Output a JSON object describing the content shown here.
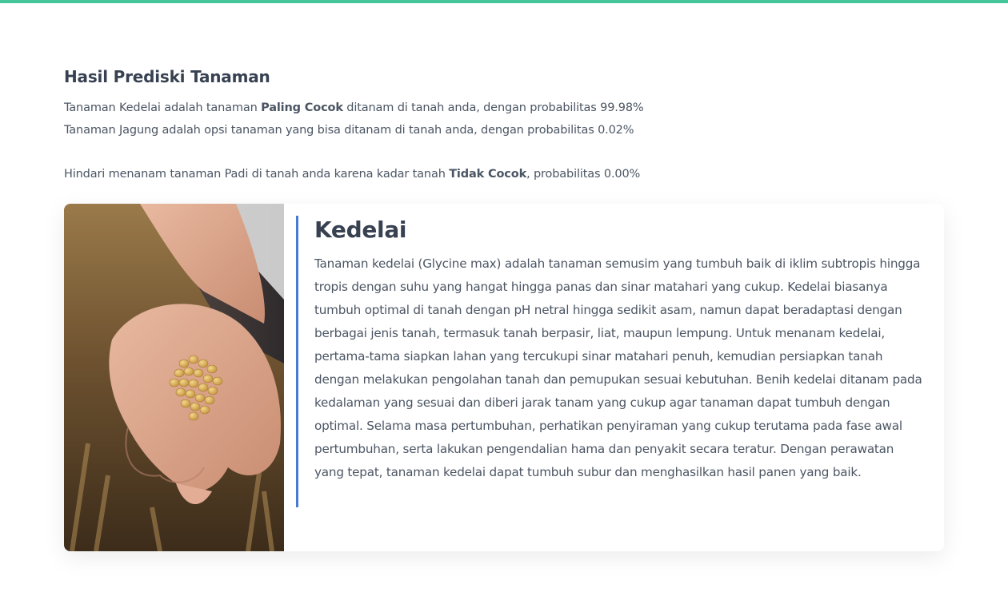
{
  "colors": {
    "accent_bar": "#45c59a",
    "card_bar": "#4a7bd0",
    "text": "#4b5563",
    "heading": "#374151"
  },
  "result": {
    "title": "Hasil Prediski Tanaman",
    "line1_pre": "Tanaman Kedelai adalah tanaman ",
    "line1_bold": "Paling Cocok",
    "line1_post": " ditanam di tanah anda, dengan probabilitas 99.98%",
    "line2": "Tanaman Jagung adalah opsi tanaman yang bisa ditanam di tanah anda, dengan probabilitas 0.02%",
    "line3_pre": "Hindari menanam tanaman Padi di tanah anda karena kadar tanah ",
    "line3_bold": "Tidak Cocok",
    "line3_post": ", probabilitas 0.00%"
  },
  "card": {
    "image_icon": "hand-holding-soybeans-photo",
    "title": "Kedelai",
    "description": "Tanaman kedelai (Glycine max) adalah tanaman semusim yang tumbuh baik di iklim subtropis hingga tropis dengan suhu yang hangat hingga panas dan sinar matahari yang cukup. Kedelai biasanya tumbuh optimal di tanah dengan pH netral hingga sedikit asam, namun dapat beradaptasi dengan berbagai jenis tanah, termasuk tanah berpasir, liat, maupun lempung. Untuk menanam kedelai, pertama-tama siapkan lahan yang tercukupi sinar matahari penuh, kemudian persiapkan tanah dengan melakukan pengolahan tanah dan pemupukan sesuai kebutuhan. Benih kedelai ditanam pada kedalaman yang sesuai dan diberi jarak tanam yang cukup agar tanaman dapat tumbuh dengan optimal. Selama masa pertumbuhan, perhatikan penyiraman yang cukup terutama pada fase awal pertumbuhan, serta lakukan pengendalian hama dan penyakit secara teratur. Dengan perawatan yang tepat, tanaman kedelai dapat tumbuh subur dan menghasilkan hasil panen yang baik."
  }
}
